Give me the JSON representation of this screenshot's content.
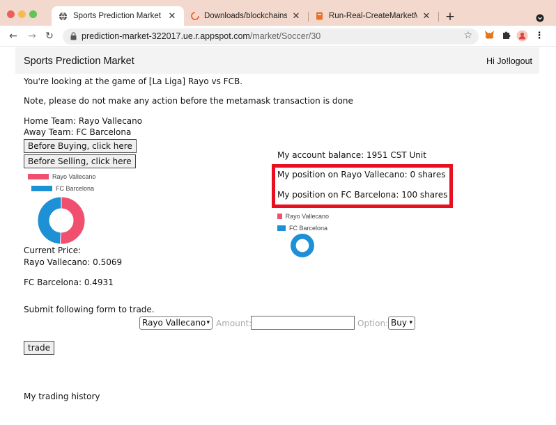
{
  "browser": {
    "tabs": [
      {
        "title": "Sports Prediction Market",
        "active": true,
        "icon": "globe-icon"
      },
      {
        "title": "Downloads/blockchains/cu_pr",
        "active": false,
        "icon": "loading-spinner-icon"
      },
      {
        "title": "Run-Real-CreateMarketMaker",
        "active": false,
        "icon": "page-icon"
      }
    ],
    "new_tab": "+",
    "url_host": "prediction-market-322017.ue.r.appspot.com",
    "url_path": "/market/Soccer/30"
  },
  "header": {
    "brand": "Sports Prediction Market",
    "greeting": "Hi Jo!",
    "logout": "logout"
  },
  "game": {
    "intro": "You're looking at the game of [La Liga] Rayo vs FCB.",
    "note": "Note, please do not make any action before the metamask transaction is done",
    "home": "Home Team: Rayo Vallecano",
    "away": "Away Team: FC Barcelona",
    "before_buying": "Before Buying, click here",
    "before_selling": "Before Selling, click here"
  },
  "price_chart": {
    "legend": [
      {
        "label": "Rayo Vallecano",
        "color": "#f0506e"
      },
      {
        "label": "FC Barcelona",
        "color": "#1e90d6"
      }
    ]
  },
  "prices": {
    "heading": "Current Price:",
    "rayo": "Rayo Vallecano: 0.5069",
    "fcb": "FC Barcelona: 0.4931"
  },
  "account": {
    "balance": "My account balance: 1951 CST Unit",
    "pos_rayo": "My position on Rayo Vallecano: 0 shares",
    "pos_fcb": "My position on FC Barcelona: 100 shares"
  },
  "position_chart": {
    "legend": [
      {
        "label": "Rayo Vallecano",
        "color": "#f0506e"
      },
      {
        "label": "FC Barcelona",
        "color": "#1e90d6"
      }
    ]
  },
  "chart_data": [
    {
      "type": "pie",
      "categories": [
        "Rayo Vallecano",
        "FC Barcelona"
      ],
      "values": [
        0.5069,
        0.4931
      ],
      "colors": [
        "#f0506e",
        "#1e90d6"
      ]
    },
    {
      "type": "pie",
      "categories": [
        "Rayo Vallecano",
        "FC Barcelona"
      ],
      "values": [
        0,
        100
      ],
      "colors": [
        "#f0506e",
        "#1e90d6"
      ]
    }
  ],
  "trade_form": {
    "intro": "Submit following form to trade.",
    "team_selected": "Rayo Vallecano",
    "amount_label": "Amount:",
    "amount_value": "",
    "option_label": "Option:",
    "option_selected": "Buy",
    "submit": "trade"
  },
  "history": {
    "heading": "My trading history"
  }
}
